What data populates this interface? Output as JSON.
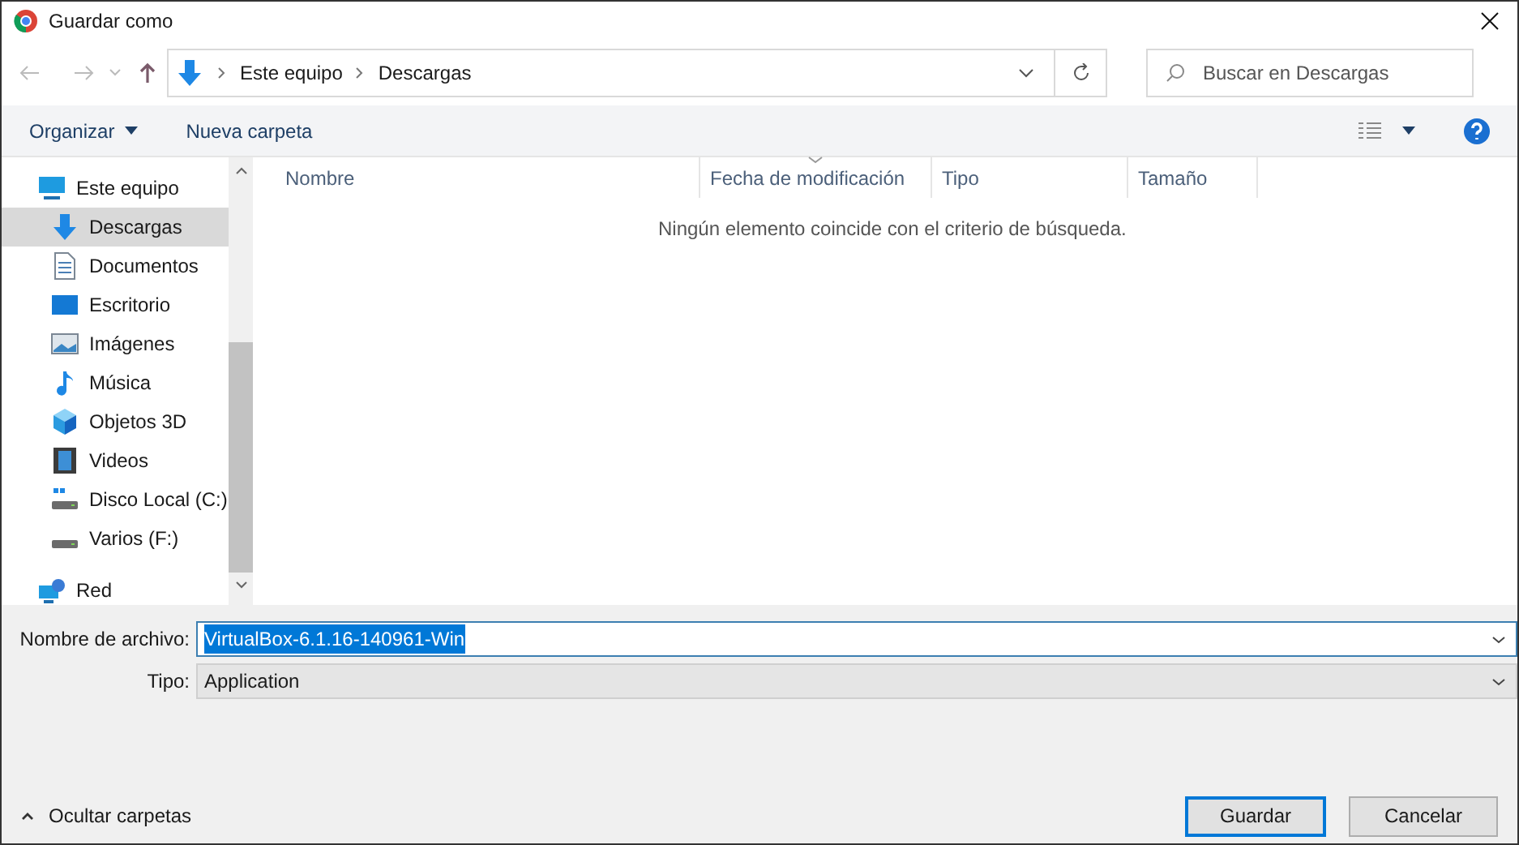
{
  "window": {
    "title": "Guardar como"
  },
  "address": {
    "path": [
      "Este equipo",
      "Descargas"
    ]
  },
  "search": {
    "placeholder": "Buscar en Descargas"
  },
  "toolbar": {
    "organize": "Organizar",
    "new_folder": "Nueva carpeta"
  },
  "sidebar": {
    "items": [
      {
        "label": "Este equipo",
        "kind": "computer",
        "selected": false,
        "children": [
          {
            "label": "Descargas",
            "kind": "download",
            "selected": true
          },
          {
            "label": "Documentos",
            "kind": "document",
            "selected": false
          },
          {
            "label": "Escritorio",
            "kind": "desktop",
            "selected": false
          },
          {
            "label": "Imágenes",
            "kind": "pictures",
            "selected": false
          },
          {
            "label": "Música",
            "kind": "music",
            "selected": false
          },
          {
            "label": "Objetos 3D",
            "kind": "cube",
            "selected": false
          },
          {
            "label": "Videos",
            "kind": "video",
            "selected": false
          },
          {
            "label": "Disco Local (C:)",
            "kind": "system-drive",
            "selected": false
          },
          {
            "label": "Varios (F:)",
            "kind": "drive",
            "selected": false
          }
        ]
      },
      {
        "label": "Red",
        "kind": "network",
        "selected": false
      }
    ]
  },
  "table": {
    "columns": [
      {
        "label": "Nombre",
        "sorted": false
      },
      {
        "label": "Fecha de modificación",
        "sorted": true
      },
      {
        "label": "Tipo",
        "sorted": false
      },
      {
        "label": "Tamaño",
        "sorted": false
      }
    ],
    "empty_message": "Ningún elemento coincide con el criterio de búsqueda."
  },
  "form": {
    "filename_label": "Nombre de archivo:",
    "filename": "VirtualBox-6.1.16-140961-Win",
    "filename_text_selected": true,
    "type_label": "Tipo:",
    "type": "Application"
  },
  "footer": {
    "toggle": "Ocultar carpetas",
    "buttons": [
      {
        "label": "Guardar",
        "kind": "primary"
      },
      {
        "label": "Cancelar",
        "kind": "secondary"
      }
    ]
  }
}
